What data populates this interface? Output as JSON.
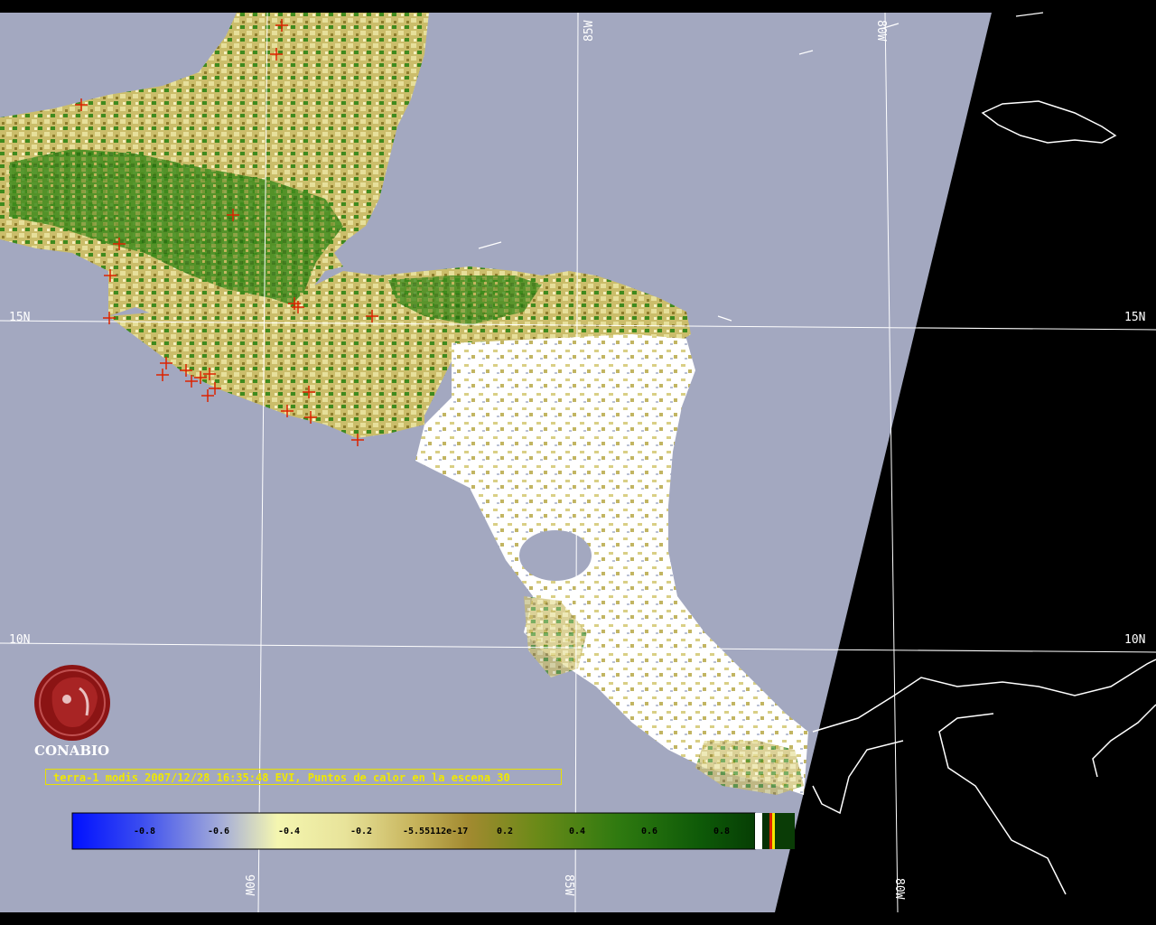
{
  "caption": "terra-1 modis 2007/12/28 16:35:48 EVI, Puntos de calor en la escena 30",
  "logo_text": "CONABIO",
  "graticule": {
    "lat_labels": [
      "15N",
      "10N"
    ],
    "lon_labels_top": [
      "85W",
      "80W"
    ],
    "lon_labels_bottom": [
      "90W",
      "85W",
      "80W"
    ]
  },
  "colorbar": {
    "tick_labels": [
      "-0.8",
      "-0.6",
      "-0.4",
      "-0.2",
      "-5.55112e-17",
      "0.2",
      "0.4",
      "0.6",
      "0.8"
    ]
  },
  "colors": {
    "ocean": "#a3a8c0",
    "no_data": "#000000",
    "cloud": "#ffffff",
    "hotspot": "#dd2200",
    "caption": "#f0e800",
    "logo": "#8b1414"
  },
  "icons": {
    "hotspot_marker": "red-cross-icon",
    "logo": "conabio-logo-icon"
  }
}
